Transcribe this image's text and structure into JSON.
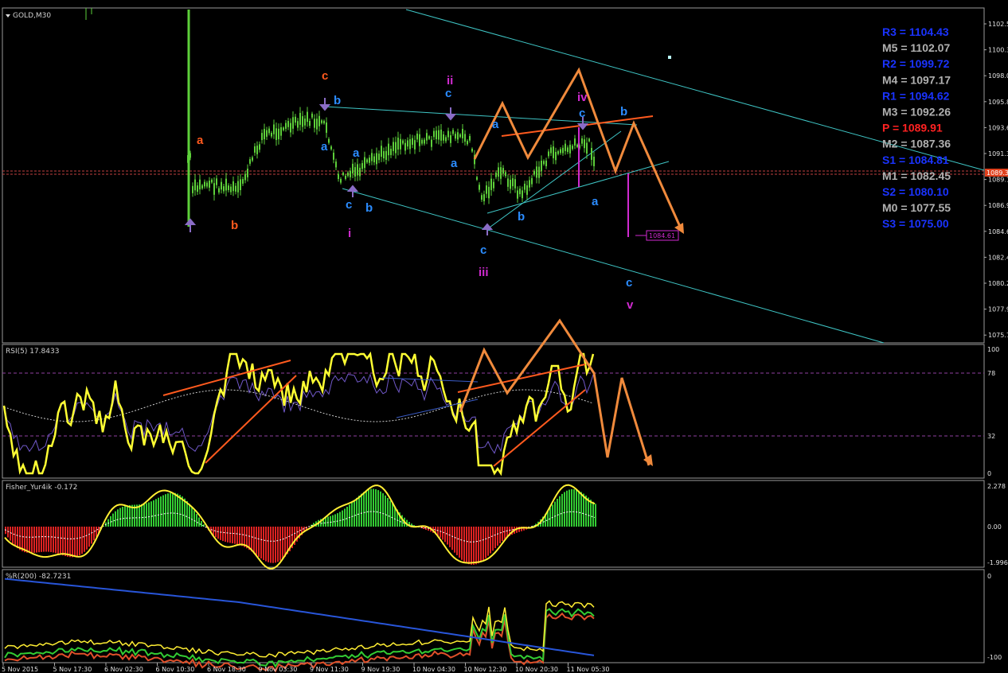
{
  "header": {
    "title": "GOLD,M30"
  },
  "colors": {
    "background": "#000000",
    "candle": "#5dcf3a",
    "channel": "#3fc6c6",
    "projection": "#f08a3c",
    "rsi": "#ffff33",
    "fisher_up": "#33cc33",
    "fisher_down": "#dd2222",
    "pivot_r": "#1a33ff",
    "pivot_m": "#b0b0b0",
    "pivot_p": "#ff2222",
    "label_blue": "#2b8cff",
    "label_orange": "#ff5a1e",
    "label_magenta": "#d02ad0"
  },
  "price_axis": [
    "1102.5",
    "1100.3",
    "1098.0",
    "1095.8",
    "1093.6",
    "1091.3",
    "1089.1",
    "1086.9",
    "1084.6",
    "1082.4",
    "1080.2",
    "1077.9",
    "1075.7"
  ],
  "current_price": "1089.3",
  "pivots": [
    {
      "label": "R3",
      "value": "1104.43",
      "kind": "r"
    },
    {
      "label": "M5",
      "value": "1102.07",
      "kind": "m"
    },
    {
      "label": "R2",
      "value": "1099.72",
      "kind": "r"
    },
    {
      "label": "M4",
      "value": "1097.17",
      "kind": "m"
    },
    {
      "label": "R1",
      "value": "1094.62",
      "kind": "r"
    },
    {
      "label": "M3",
      "value": "1092.26",
      "kind": "m"
    },
    {
      "label": "P",
      "value": "1089.91",
      "kind": "p"
    },
    {
      "label": "M2",
      "value": "1087.36",
      "kind": "m"
    },
    {
      "label": "S1",
      "value": "1084.81",
      "kind": "r"
    },
    {
      "label": "M1",
      "value": "1082.45",
      "kind": "m"
    },
    {
      "label": "S2",
      "value": "1080.10",
      "kind": "r"
    },
    {
      "label": "M0",
      "value": "1077.55",
      "kind": "m"
    },
    {
      "label": "S3",
      "value": "1075.00",
      "kind": "r"
    }
  ],
  "target_label": "1084.61",
  "wave_labels": {
    "a1": "a",
    "b1": "b",
    "c1": "c",
    "b2": "b",
    "a2": "a",
    "a3": "a",
    "c2": "c",
    "b3": "b",
    "i": "i",
    "ii": "ii",
    "c3": "c",
    "a4": "a",
    "a5": "a",
    "c4": "c",
    "iii": "iii",
    "b4": "b",
    "iv": "iv",
    "c5": "c",
    "b5": "b",
    "a6": "a",
    "c6": "c",
    "v": "v"
  },
  "rsi": {
    "label": "RSI(5) 17.8433",
    "levels": [
      "100",
      "78",
      "32",
      "0"
    ]
  },
  "fisher": {
    "label": "Fisher_Yur4ik -0.172",
    "levels": [
      "2.278",
      "0.00",
      "-1.996"
    ]
  },
  "wpr": {
    "label": "%R(200) -82.7231",
    "levels": [
      "0",
      "-100"
    ]
  },
  "time_axis": [
    "5 Nov 2015",
    "5 Nov 17:30",
    "6 Nov 02:30",
    "6 Nov 10:30",
    "6 Nov 18:30",
    "9 Nov 03:30",
    "9 Nov 11:30",
    "9 Nov 19:30",
    "10 Nov 04:30",
    "10 Nov 12:30",
    "10 Nov 20:30",
    "11 Nov 05:30"
  ]
}
